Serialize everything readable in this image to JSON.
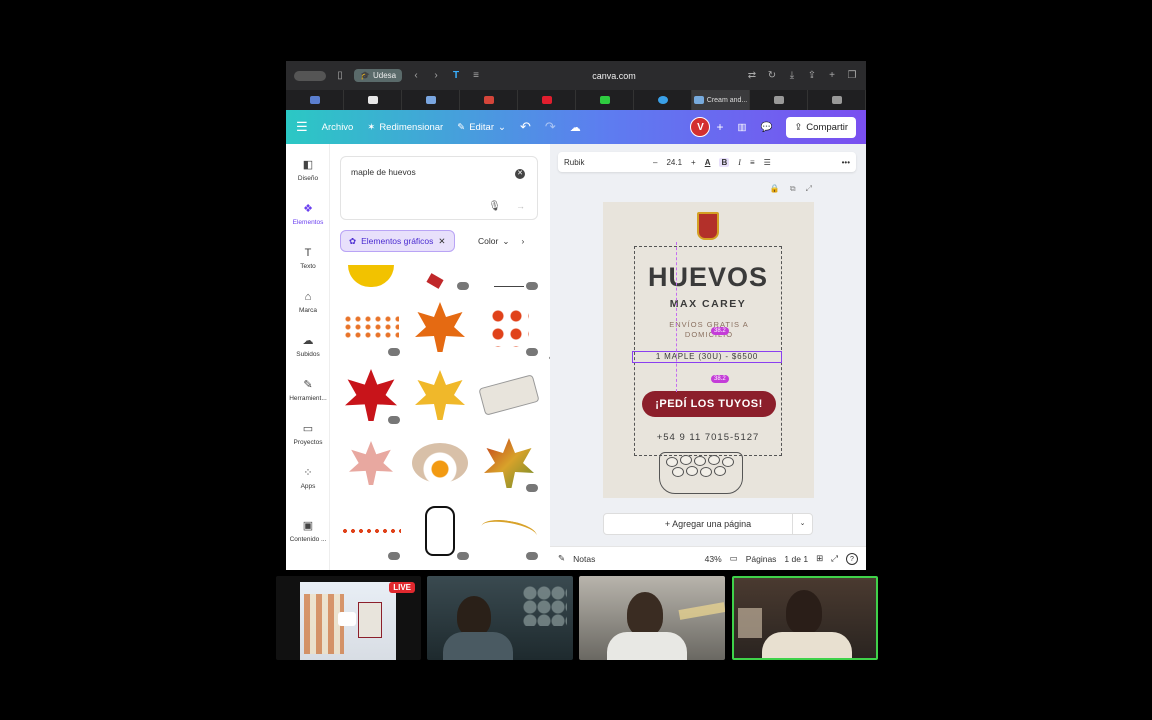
{
  "browser": {
    "profile_label": "Udesa",
    "url": "canva.com",
    "active_tab_label": "Cream and..."
  },
  "toolbar": {
    "file_label": "Archivo",
    "resize_label": "Redimensionar",
    "edit_label": "Editar",
    "avatar_letter": "V",
    "share_label": "Compartir"
  },
  "rail": {
    "items": [
      {
        "label": "Diseño",
        "icon": "layout-icon"
      },
      {
        "label": "Elementos",
        "icon": "shapes-icon"
      },
      {
        "label": "Texto",
        "icon": "text-icon"
      },
      {
        "label": "Marca",
        "icon": "brand-icon"
      },
      {
        "label": "Subidos",
        "icon": "cloud-upload-icon"
      },
      {
        "label": "Herramient...",
        "icon": "pencil-icon"
      },
      {
        "label": "Proyectos",
        "icon": "folder-icon"
      },
      {
        "label": "Apps",
        "icon": "apps-icon"
      },
      {
        "label": "Contenido ...",
        "icon": "image-icon"
      }
    ]
  },
  "search": {
    "query": "maple de huevos",
    "filter_chip": "Elementos gráficos",
    "color_filter": "Color"
  },
  "text_toolbar": {
    "font": "Rubik",
    "size": "24.1"
  },
  "design": {
    "title": "HUEVOS",
    "subtitle": "MAX CAREY",
    "shipping_line1": "ENVÍOS GRATIS A",
    "shipping_line2": "DOMICILIO",
    "price": "1 MAPLE (30U) - $6500",
    "cta": "¡PEDÍ LOS TUYOS!",
    "phone": "+54 9 11 7015-5127",
    "guide_badge_top": "38.2",
    "guide_badge_bottom": "38.2"
  },
  "editor": {
    "add_page_label": "+ Agregar una página"
  },
  "footer": {
    "notes_label": "Notas",
    "zoom": "43%",
    "pages_label": "Páginas",
    "page_count": "1 de 1"
  },
  "call": {
    "live_badge": "LIVE"
  },
  "colors": {
    "accent": "#7a4ff0",
    "cta_red": "#8c1f2b",
    "page_bg": "#e8e4dc"
  }
}
